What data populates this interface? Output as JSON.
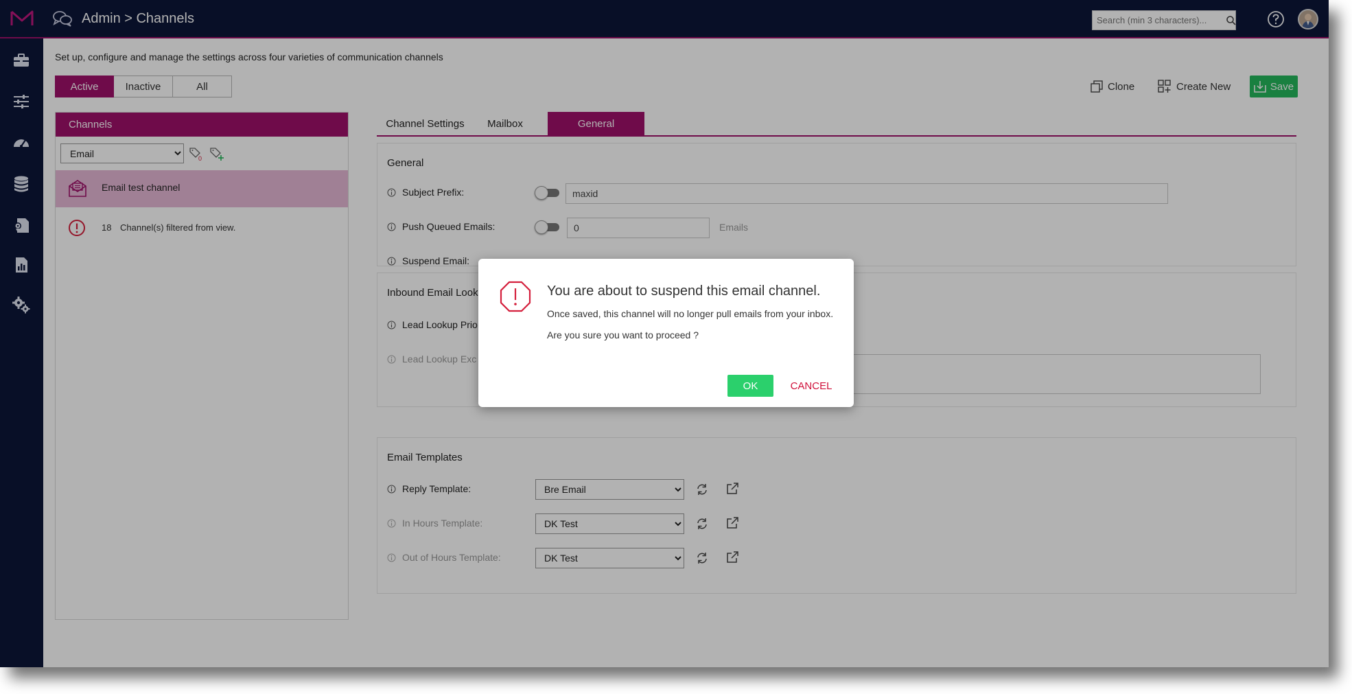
{
  "header": {
    "title": "Admin > Channels",
    "search_placeholder": "Search (min 3 characters)..."
  },
  "nav": {
    "icons": [
      "briefcase-icon",
      "sliders-icon",
      "dashboard-gauge-icon",
      "database-icon",
      "map-document-icon",
      "report-icon",
      "settings-gears-icon"
    ]
  },
  "main": {
    "description": "Set up, configure and manage the settings across four varieties of communication channels",
    "filters": [
      {
        "label": "Active",
        "active": true
      },
      {
        "label": "Inactive",
        "active": false
      },
      {
        "label": "All",
        "active": false
      }
    ],
    "toolbar": {
      "clone_label": "Clone",
      "create_new_label": "Create New",
      "save_label": "Save"
    }
  },
  "channels_panel": {
    "title": "Channels",
    "type_selected": "Email",
    "tag_count": "0",
    "selected_channel": "Email test channel",
    "filtered_count": "18",
    "filtered_text": "Channel(s) filtered from view."
  },
  "tabs": [
    {
      "label": "Channel Settings",
      "active": false
    },
    {
      "label": "Mailbox",
      "active": false
    },
    {
      "label": "General",
      "active": true
    }
  ],
  "general": {
    "title": "General",
    "subject_prefix_label": "Subject Prefix:",
    "subject_prefix_value": "maxid",
    "subject_prefix_enabled": false,
    "push_queued_label": "Push Queued Emails:",
    "push_queued_value": "0",
    "push_queued_enabled": false,
    "push_queued_unit": "Emails",
    "suspend_label": "Suspend Email:"
  },
  "inbound": {
    "title": "Inbound Email Looku",
    "lead_priority_label": "Lead Lookup Prio",
    "lead_exclusion_label": "Lead Lookup Exc"
  },
  "templates": {
    "title": "Email Templates",
    "reply_label": "Reply Template:",
    "reply_value": "Bre Email",
    "in_hours_label": "In Hours Template:",
    "in_hours_value": "DK Test",
    "out_hours_label": "Out of Hours Template:",
    "out_hours_value": "DK Test"
  },
  "modal": {
    "title": "You are about to suspend this email channel.",
    "line1": "Once saved, this channel will no longer pull emails from your inbox.",
    "line2": "Are you sure you want to proceed ?",
    "ok_label": "OK",
    "cancel_label": "CANCEL"
  },
  "colors": {
    "brand_magenta": "#a0106a",
    "nav_dark": "#0c1638",
    "save_green": "#24b85c",
    "ok_green": "#2bd06c",
    "cancel_red": "#d0103a",
    "warn_red": "#d41f3c"
  }
}
